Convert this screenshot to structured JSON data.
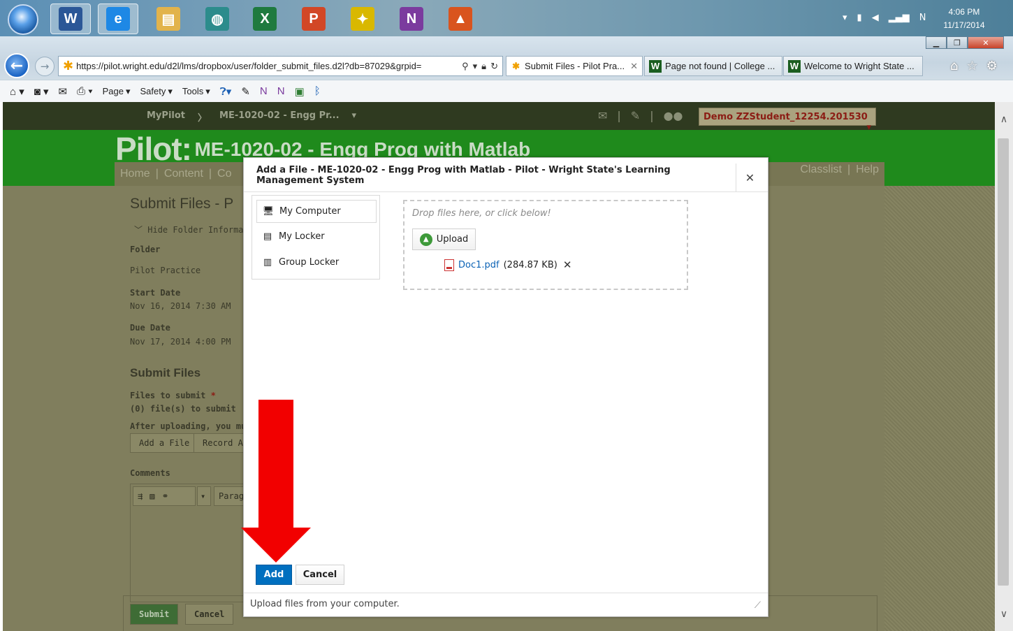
{
  "taskbar": {
    "apps": [
      {
        "name": "word",
        "glyph": "W",
        "color": "#2b5797",
        "active": true
      },
      {
        "name": "ie",
        "glyph": "e",
        "color": "#1e88e5",
        "active": true
      },
      {
        "name": "file-explorer",
        "glyph": "▤",
        "color": "#e2b34b",
        "active": false
      },
      {
        "name": "network-app",
        "glyph": "◍",
        "color": "#2c8c8c",
        "active": false
      },
      {
        "name": "excel",
        "glyph": "X",
        "color": "#1f7a3f",
        "active": false
      },
      {
        "name": "powerpoint",
        "glyph": "P",
        "color": "#d24726",
        "active": false
      },
      {
        "name": "labview",
        "glyph": "✦",
        "color": "#d9b800",
        "active": false
      },
      {
        "name": "onenote",
        "glyph": "N",
        "color": "#7b3b9e",
        "active": false
      },
      {
        "name": "matlab",
        "glyph": "▲",
        "color": "#d9541e",
        "active": false
      }
    ],
    "clock_time": "4:06 PM",
    "clock_date": "11/17/2014"
  },
  "browser": {
    "url": "https://pilot.wright.edu/d2l/lms/dropbox/user/folder_submit_files.d2l?db=87029&grpid=",
    "tabs": [
      {
        "label": "Submit Files - Pilot Pra...",
        "icon": "✱",
        "active": true
      },
      {
        "label": "Page not found | College ...",
        "icon": "W",
        "active": false
      },
      {
        "label": "Welcome to Wright State ...",
        "icon": "W",
        "active": false
      }
    ],
    "command_bar": {
      "page": "Page",
      "safety": "Safety",
      "tools": "Tools"
    }
  },
  "site": {
    "nav_mypilot": "MyPilot",
    "nav_course": "ME-1020-02 - Engg Pr...",
    "user": "Demo ZZStudent_12254.201530",
    "logo_pilot": "Pilot:",
    "logo_course": "ME-1020-02 - Engg Prog with Matlab",
    "coursebar_left": [
      "Home",
      "|",
      "Content",
      "|",
      "Co"
    ],
    "coursebar_right": [
      "Classlist",
      "|",
      "Help"
    ]
  },
  "page_content": {
    "title": "Submit Files - P",
    "hide_folder": "Hide Folder Informati",
    "folder_label": "Folder",
    "folder_value": "Pilot Practice",
    "start_label": "Start Date",
    "start_value": "Nov 16, 2014 7:30 AM",
    "due_label": "Due Date",
    "due_value": "Nov 17, 2014 4:00 PM",
    "submit_heading": "Submit Files",
    "files_to_submit": "Files to submit",
    "files_count": "(0) file(s) to submit",
    "after_uploading": "After uploading, you mu",
    "add_file_btn": "Add a File",
    "record_btn": "Record Au",
    "comments_label": "Comments",
    "paragraph_label": "Parag",
    "submit_btn": "Submit",
    "cancel_btn": "Cancel"
  },
  "modal": {
    "title": "Add a File - ME-1020-02 - Engg Prog with Matlab - Pilot - Wright State's Learning Management System",
    "sources": [
      {
        "label": "My Computer",
        "icon": "computer-icon",
        "active": true
      },
      {
        "label": "My Locker",
        "icon": "locker-icon",
        "active": false
      },
      {
        "label": "Group Locker",
        "icon": "group-locker-icon",
        "active": false
      }
    ],
    "drop_hint": "Drop files here, or click below!",
    "upload_label": "Upload",
    "file_name": "Doc1.pdf",
    "file_size": "(284.87 KB)",
    "add_label": "Add",
    "cancel_label": "Cancel",
    "footer_text": "Upload files from your computer."
  }
}
